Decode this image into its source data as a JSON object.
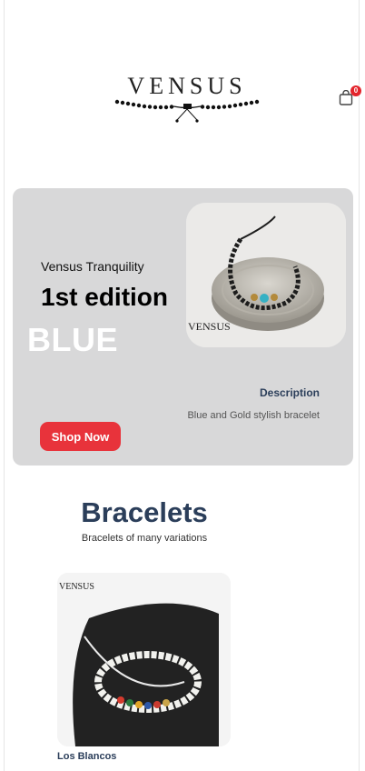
{
  "brand": {
    "logo_text": "VENSUS"
  },
  "cart": {
    "count": "0"
  },
  "hero": {
    "subtitle": "Vensus Tranquility",
    "title": "1st edition",
    "color_label": "BLUE",
    "image_watermark": "VENSUS",
    "description_heading": "Description",
    "description_text": "Blue and Gold stylish bracelet",
    "cta_label": "Shop Now"
  },
  "products_section": {
    "title": "Bracelets",
    "subtitle": "Bracelets of many variations",
    "items": [
      {
        "name": "Los Blancos",
        "image_watermark": "VENSUS"
      }
    ]
  },
  "colors": {
    "accent": "#e8333b",
    "heading": "#2b3e5a",
    "hero_bg": "#d8d8d9"
  }
}
